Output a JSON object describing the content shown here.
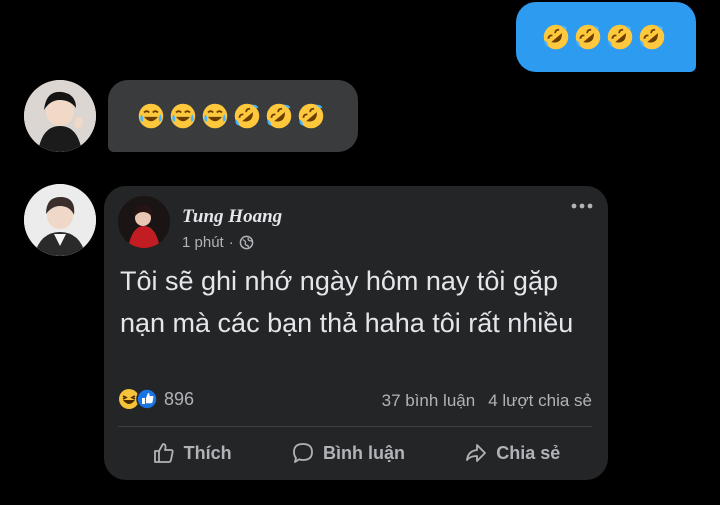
{
  "messages": {
    "outgoing": {
      "emojis": [
        "rofl-icon",
        "rofl-icon",
        "rofl-icon",
        "rofl-icon"
      ]
    },
    "incoming": {
      "emojis": [
        "joy-icon",
        "joy-icon",
        "joy-icon",
        "rofl-icon",
        "rofl-icon",
        "rofl-icon"
      ]
    }
  },
  "post": {
    "author": "Tung Hoang",
    "time": "1 phút",
    "separator": "·",
    "text": "Tôi sẽ ghi nhớ ngày hôm nay tôi gặp nạn mà các bạn thả haha tôi rất nhiều",
    "reaction_count": "896",
    "comments": "37 bình luận",
    "shares": "4 lượt chia sẻ",
    "actions": {
      "like": "Thích",
      "comment": "Bình luận",
      "share": "Chia sẻ"
    }
  },
  "colors": {
    "outgoing_bubble": "#2d9bf0",
    "incoming_bubble": "#3a3b3c",
    "card": "#242526"
  }
}
